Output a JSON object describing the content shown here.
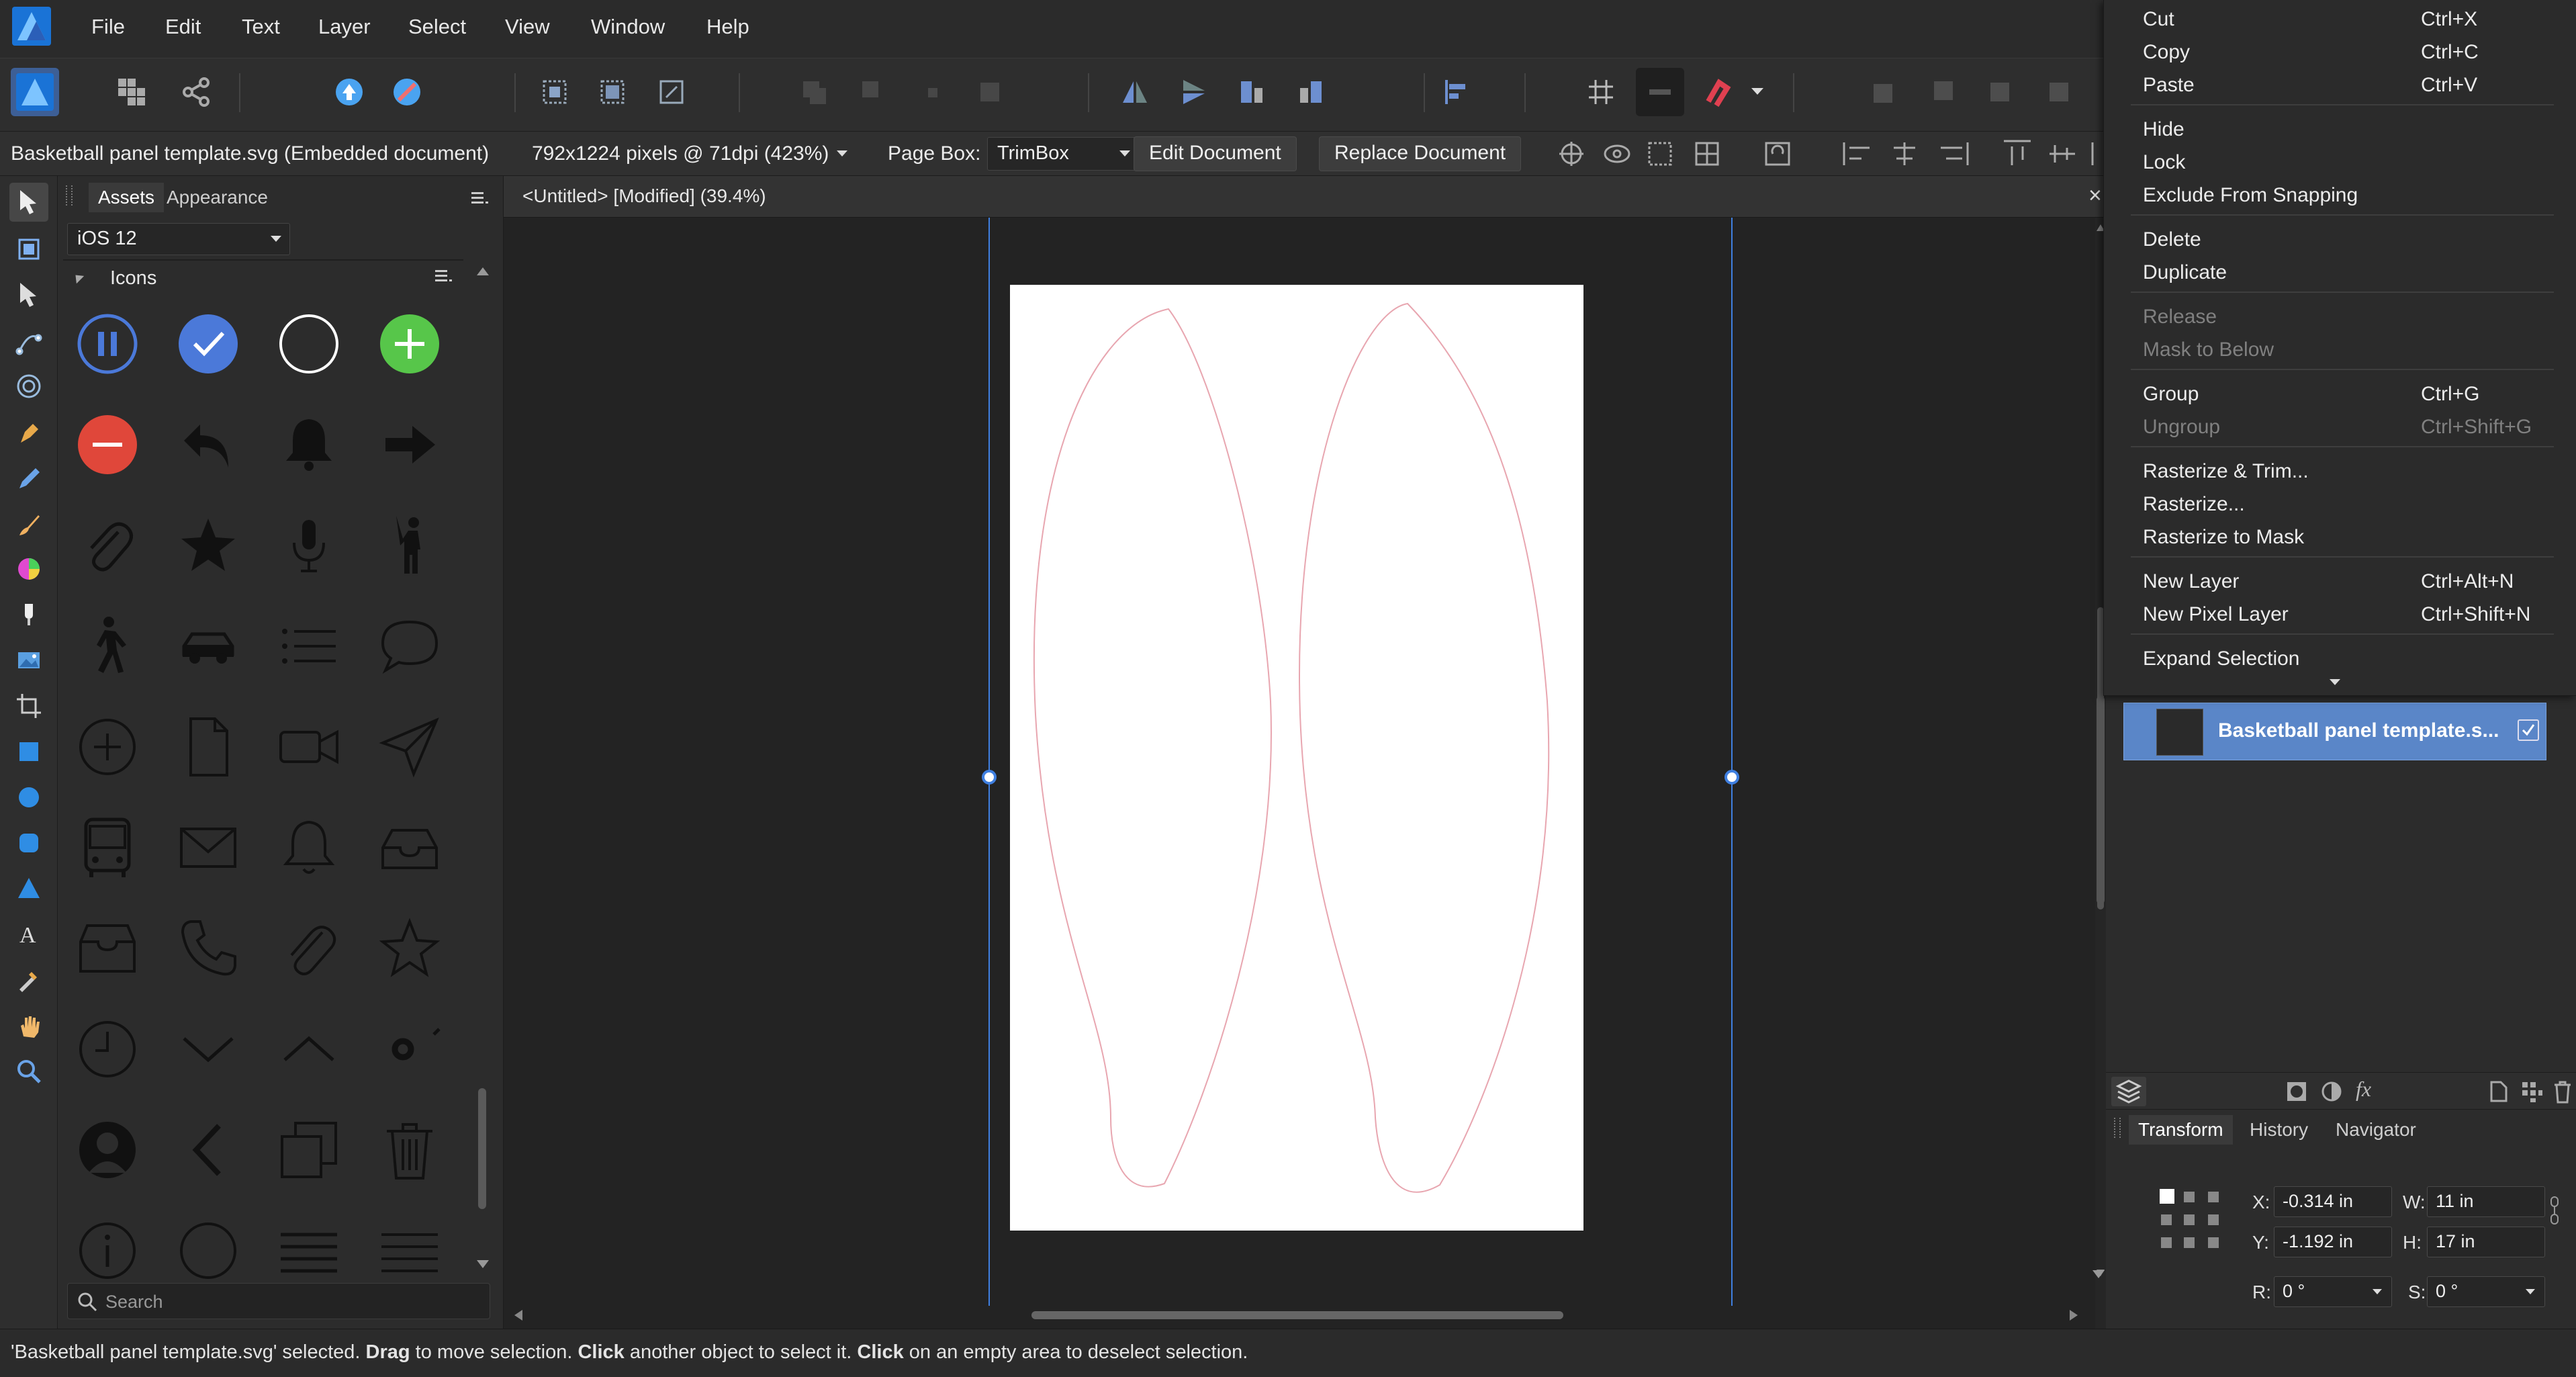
{
  "menubar": {
    "items": [
      "File",
      "Edit",
      "Text",
      "Layer",
      "Select",
      "View",
      "Window",
      "Help"
    ]
  },
  "context_bar": {
    "document_label": "Basketball panel template.svg (Embedded document)",
    "resolution": "792x1224 pixels @ 71dpi (423%)",
    "page_box_label": "Page Box:",
    "page_box_value": "TrimBox",
    "edit_document": "Edit Document",
    "replace_document": "Replace Document"
  },
  "assets_panel": {
    "tabs": [
      "Assets",
      "Appearance"
    ],
    "category": "iOS 12",
    "section": "Icons",
    "search_placeholder": "Search",
    "icons": [
      "pause-circle-icon",
      "check-circle-icon",
      "empty-circle-icon",
      "add-circle-icon",
      "minus-circle-icon",
      "reply-arrow-icon",
      "bell-filled-icon",
      "right-arrow-icon",
      "paperclip-icon",
      "star-filled-icon",
      "microphone-icon",
      "person-waving-icon",
      "walking-person-icon",
      "car-icon",
      "list-icon",
      "speech-bubble-icon",
      "plus-circle-outline-icon",
      "document-icon",
      "video-camera-icon",
      "send-plane-icon",
      "bus-icon",
      "envelope-icon",
      "bell-outline-icon",
      "inbox-tray-icon",
      "archive-tray-icon",
      "phone-icon",
      "paperclip-outline-icon",
      "star-outline-icon",
      "clock-icon",
      "chevron-down-icon",
      "chevron-up-icon",
      "loading-spinner-icon",
      "person-silhouette-icon",
      "chevron-left-icon",
      "copy-pages-icon",
      "trash-icon",
      "info-circle-icon",
      "circle-outline-icon",
      "align-lines-icon",
      "menu-lines-icon"
    ]
  },
  "document": {
    "tab_title": "<Untitled> [Modified] (39.4%)"
  },
  "context_menu": {
    "items": [
      {
        "label": "Cut",
        "shortcut": "Ctrl+X",
        "disabled": false
      },
      {
        "label": "Copy",
        "shortcut": "Ctrl+C",
        "disabled": false
      },
      {
        "label": "Paste",
        "shortcut": "Ctrl+V",
        "disabled": false
      },
      {
        "label": "Hide",
        "shortcut": "",
        "disabled": false
      },
      {
        "label": "Lock",
        "shortcut": "",
        "disabled": false
      },
      {
        "label": "Exclude From Snapping",
        "shortcut": "",
        "disabled": false
      },
      {
        "label": "Delete",
        "shortcut": "",
        "disabled": false
      },
      {
        "label": "Duplicate",
        "shortcut": "",
        "disabled": false
      },
      {
        "label": "Release",
        "shortcut": "",
        "disabled": true
      },
      {
        "label": "Mask to Below",
        "shortcut": "",
        "disabled": true
      },
      {
        "label": "Group",
        "shortcut": "Ctrl+G",
        "disabled": false
      },
      {
        "label": "Ungroup",
        "shortcut": "Ctrl+Shift+G",
        "disabled": true
      },
      {
        "label": "Rasterize & Trim...",
        "shortcut": "",
        "disabled": false
      },
      {
        "label": "Rasterize...",
        "shortcut": "",
        "disabled": false
      },
      {
        "label": "Rasterize to Mask",
        "shortcut": "",
        "disabled": false
      },
      {
        "label": "New Layer",
        "shortcut": "Ctrl+Alt+N",
        "disabled": false
      },
      {
        "label": "New Pixel Layer",
        "shortcut": "Ctrl+Shift+N",
        "disabled": false
      },
      {
        "label": "Expand Selection",
        "shortcut": "",
        "disabled": false
      }
    ]
  },
  "layers": {
    "selected_layer": "Basketball panel template.s..."
  },
  "transform_panel": {
    "tabs": [
      "Transform",
      "History",
      "Navigator"
    ],
    "x_label": "X:",
    "x_value": "-0.314 in",
    "y_label": "Y:",
    "y_value": "-1.192 in",
    "w_label": "W:",
    "w_value": "11 in",
    "h_label": "H:",
    "h_value": "17 in",
    "r_label": "R:",
    "r_value": "0 °",
    "s_label": "S:",
    "s_value": "0 °"
  },
  "status_bar": {
    "part1": "'Basketball panel template.svg' selected. ",
    "bold1": "Drag",
    "part2": " to move selection. ",
    "bold2": "Click",
    "part3": " another object to select it. ",
    "bold3": "Click",
    "part4": " on an empty area to deselect selection."
  },
  "colors": {
    "accent_blue": "#4b79d9",
    "selection_blue": "#5b8fd6",
    "add_green": "#57c64a",
    "delete_red": "#e0473a"
  }
}
